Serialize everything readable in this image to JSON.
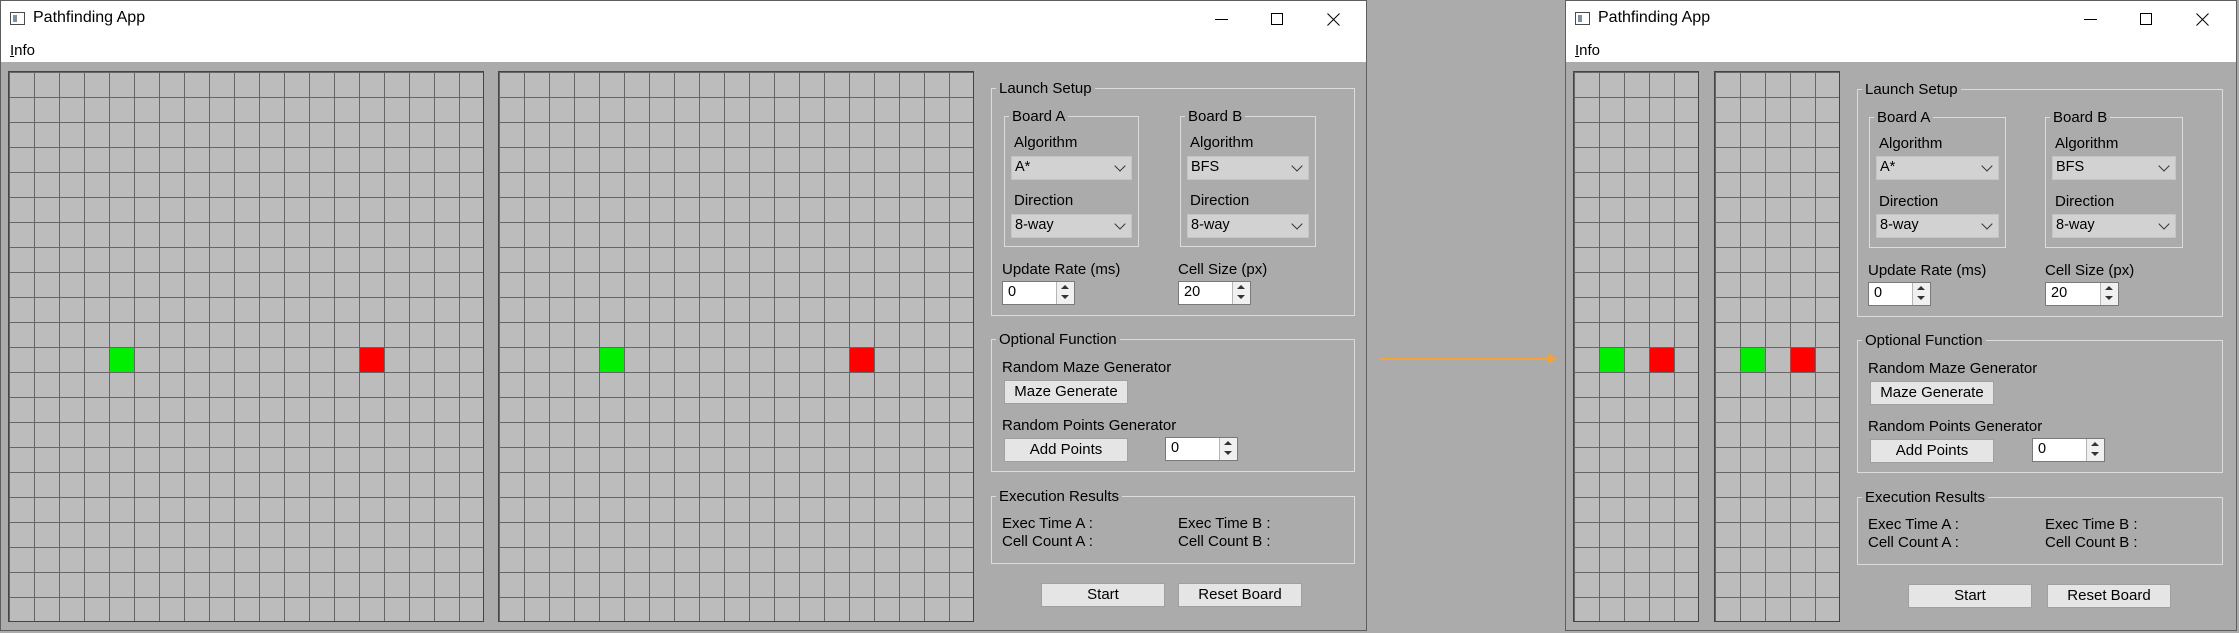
{
  "app": {
    "title": "Pathfinding App",
    "menu_info": "Info"
  },
  "windows": [
    {
      "launch_setup": "Launch Setup",
      "board_a": {
        "legend": "Board A",
        "algorithm_label": "Algorithm",
        "algorithm": "A*",
        "direction_label": "Direction",
        "direction": "8-way"
      },
      "board_b": {
        "legend": "Board B",
        "algorithm_label": "Algorithm",
        "algorithm": "BFS",
        "direction_label": "Direction",
        "direction": "8-way"
      },
      "update_rate_label": "Update Rate (ms)",
      "update_rate": "0",
      "cell_size_label": "Cell Size (px)",
      "cell_size": "20",
      "optional_function": "Optional Function",
      "maze_label": "Random Maze Generator",
      "maze_button": "Maze Generate",
      "points_label": "Random Points Generator",
      "points_button": "Add Points",
      "points_count": "0",
      "execution_results": "Execution Results",
      "exec_time_a": "Exec Time A :",
      "cell_count_a": "Cell Count A :",
      "exec_time_b": "Exec Time B :",
      "cell_count_b": "Cell Count B :",
      "start_button": "Start",
      "reset_button": "Reset Board"
    },
    {
      "launch_setup": "Launch Setup",
      "board_a": {
        "legend": "Board A",
        "algorithm_label": "Algorithm",
        "algorithm": "A*",
        "direction_label": "Direction",
        "direction": "8-way"
      },
      "board_b": {
        "legend": "Board B",
        "algorithm_label": "Algorithm",
        "algorithm": "BFS",
        "direction_label": "Direction",
        "direction": "8-way"
      },
      "update_rate_label": "Update Rate (ms)",
      "update_rate": "0",
      "cell_size_label": "Cell Size (px)",
      "cell_size": "20",
      "optional_function": "Optional Function",
      "maze_label": "Random Maze Generator",
      "maze_button": "Maze Generate",
      "points_label": "Random Points Generator",
      "points_button": "Add Points",
      "points_count": "0",
      "execution_results": "Execution Results",
      "exec_time_a": "Exec Time A :",
      "cell_count_a": "Cell Count A :",
      "exec_time_b": "Exec Time B :",
      "cell_count_b": "Cell Count B :",
      "start_button": "Start",
      "reset_button": "Reset Board"
    }
  ],
  "colors": {
    "start_cell": "#00ee00",
    "end_cell": "#ff0000",
    "transition_arrow": "#f5a338"
  },
  "icons": {
    "app": "window-icon",
    "minimize": "minimize-icon",
    "maximize": "maximize-icon",
    "close": "close-icon",
    "dropdown": "chevron-down-icon",
    "spin_up": "spin-up-icon",
    "spin_down": "spin-down-icon",
    "transition": "arrow-right-icon"
  }
}
